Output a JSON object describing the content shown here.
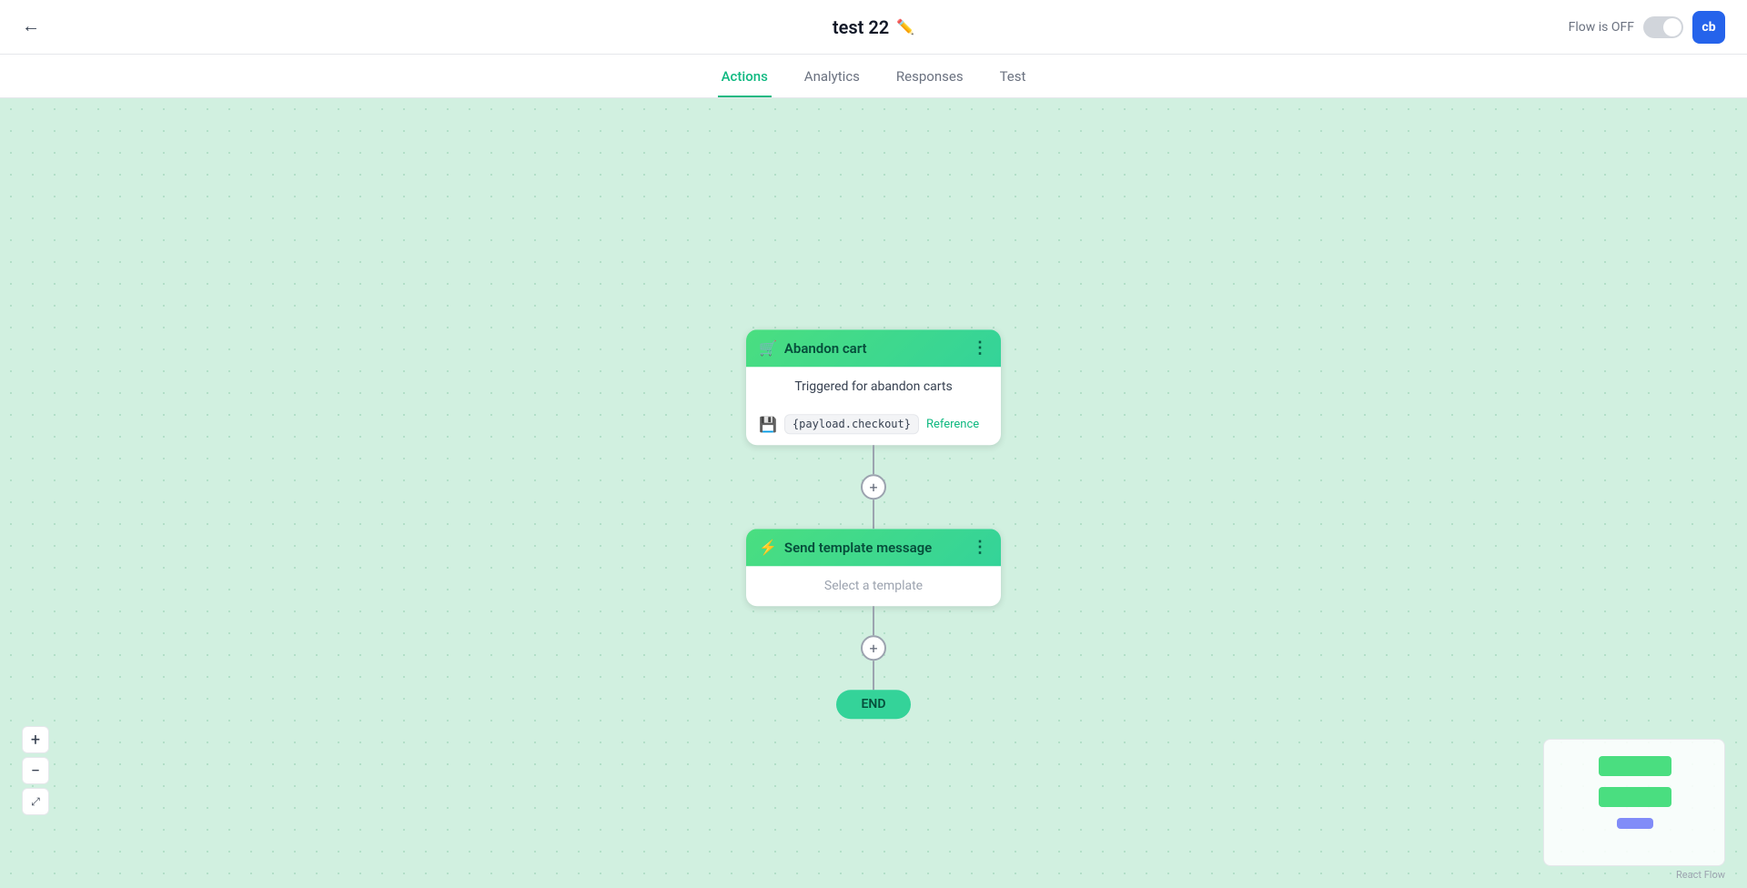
{
  "header": {
    "title": "test 22",
    "edit_icon": "✏️",
    "back_icon": "←",
    "flow_status": "Flow is OFF",
    "avatar": "cb"
  },
  "tabs": [
    {
      "label": "Actions",
      "active": true
    },
    {
      "label": "Analytics",
      "active": false
    },
    {
      "label": "Responses",
      "active": false
    },
    {
      "label": "Test",
      "active": false
    }
  ],
  "flow": {
    "abandon_cart_card": {
      "title": "Abandon cart",
      "subtitle": "Triggered for abandon carts",
      "payload": "{payload.checkout}",
      "reference": "Reference",
      "icon": "🛒"
    },
    "send_template_card": {
      "title": "Send template message",
      "body": "Select a template",
      "icon": "⚡"
    },
    "end_node": "END"
  },
  "zoom": {
    "plus": "+",
    "minus": "−",
    "fit": "⤢"
  },
  "react_flow_label": "React Flow"
}
